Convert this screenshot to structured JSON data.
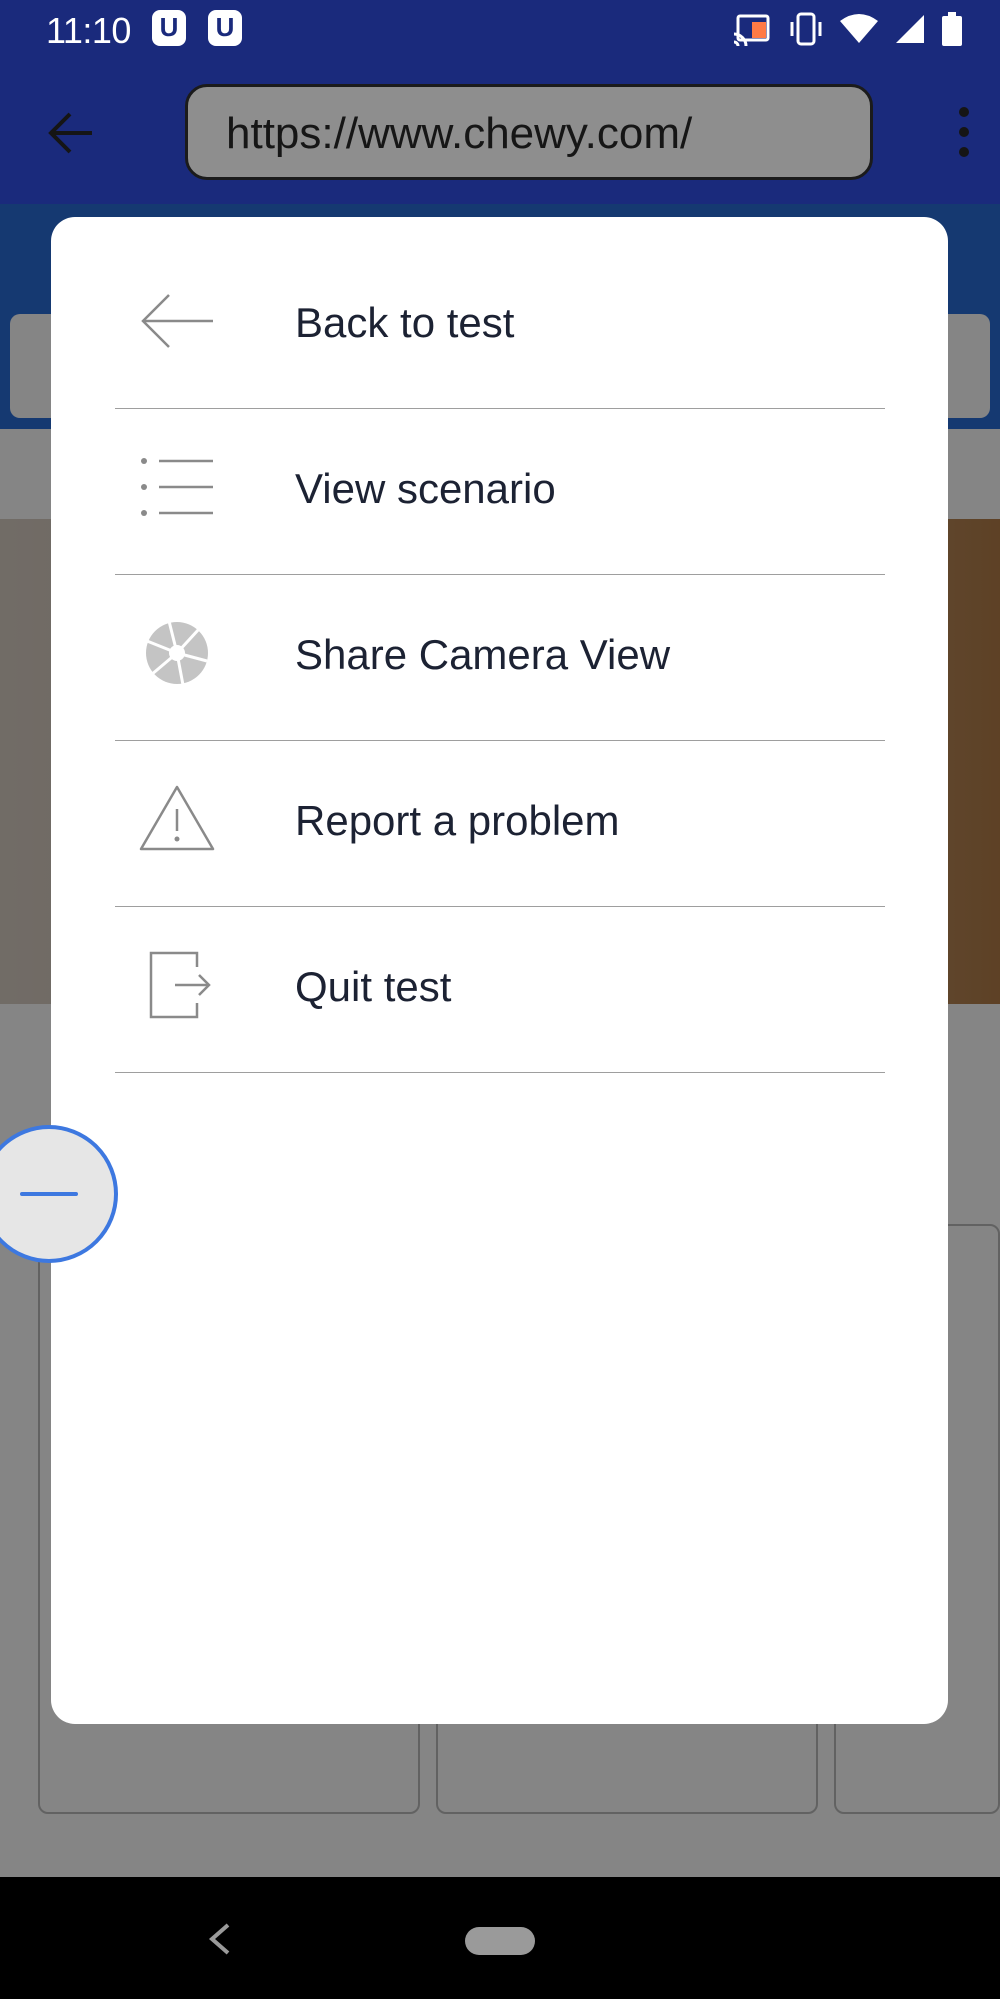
{
  "status_bar": {
    "time": "11:10",
    "badges": [
      "U",
      "U"
    ],
    "icons": [
      "cast-icon",
      "vibrate-icon",
      "wifi-icon",
      "signal-icon",
      "battery-icon"
    ]
  },
  "browser": {
    "url": "https://www.chewy.com/",
    "icons": [
      "back-arrow-icon",
      "more-vert-icon"
    ]
  },
  "menu": {
    "items": [
      {
        "label": "Back to test",
        "icon": "back-arrow-icon"
      },
      {
        "label": "View scenario",
        "icon": "list-icon"
      },
      {
        "label": "Share Camera View",
        "icon": "camera-aperture-icon"
      },
      {
        "label": "Report a problem",
        "icon": "warning-icon"
      },
      {
        "label": "Quit test",
        "icon": "exit-icon"
      }
    ]
  },
  "floating_button": {
    "icon": "minus-icon"
  },
  "nav": {
    "icons": [
      "nav-back-icon",
      "home-pill-icon"
    ]
  },
  "colors": {
    "status_bar": "#1a2a7c",
    "accent_blue": "#3d78e0",
    "menu_text": "#1c2233",
    "divider": "#9e9e9e"
  }
}
